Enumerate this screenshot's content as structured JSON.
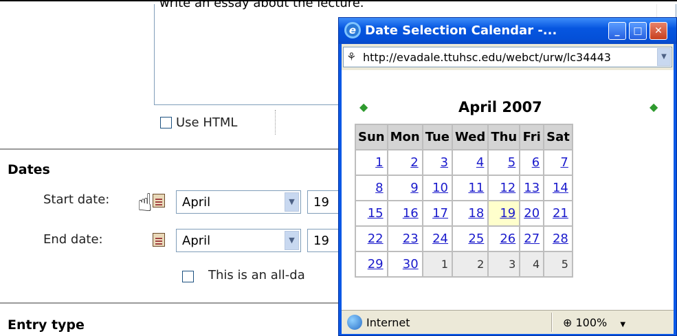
{
  "form": {
    "textarea_text": "write an essay about the lecture.",
    "use_html_label": "Use HTML",
    "dates_heading": "Dates",
    "start_label": "Start date:",
    "end_label": "End date:",
    "start_month": "April",
    "start_day": "19",
    "end_month": "April",
    "end_day": "19",
    "allday_label": "This is an all-da",
    "entry_type_heading": "Entry type"
  },
  "popup": {
    "title": "Date Selection Calendar -...",
    "url": "http://evadale.ttuhsc.edu/webct/urw/lc34443",
    "month_label": "April 2007",
    "weekdays": [
      "Sun",
      "Mon",
      "Tue",
      "Wed",
      "Thu",
      "Fri",
      "Sat"
    ],
    "weeks": [
      [
        "1",
        "2",
        "3",
        "4",
        "5",
        "6",
        "7"
      ],
      [
        "8",
        "9",
        "10",
        "11",
        "12",
        "13",
        "14"
      ],
      [
        "15",
        "16",
        "17",
        "18",
        "19",
        "20",
        "21"
      ],
      [
        "22",
        "23",
        "24",
        "25",
        "26",
        "27",
        "28"
      ],
      [
        "29",
        "30",
        "1",
        "2",
        "3",
        "4",
        "5"
      ]
    ],
    "selected_day": "19",
    "status_zone": "Internet",
    "zoom": "100%",
    "colors": {
      "title_bar": "#0656e0",
      "today_bg": "#ffffcc",
      "link": "#1a1acc"
    }
  }
}
